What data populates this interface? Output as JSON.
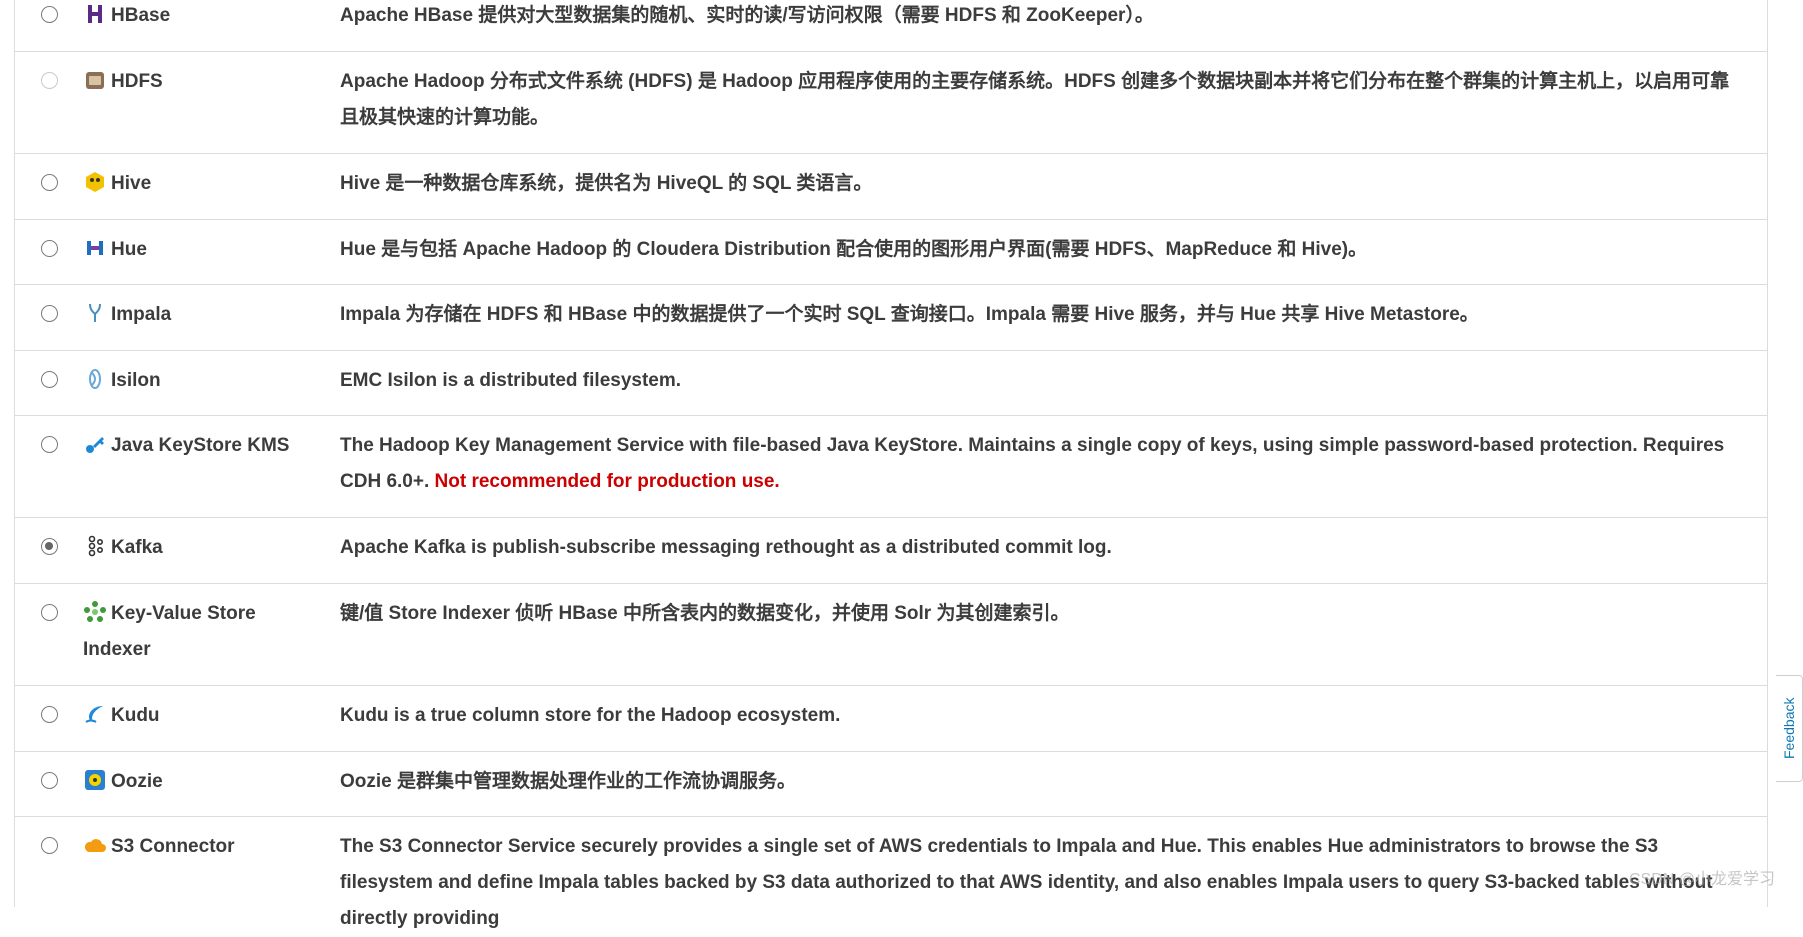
{
  "rows": [
    {
      "name": "HBase",
      "icon": "hbase-icon",
      "desc": "Apache HBase 提供对大型数据集的随机、实时的读/写访问权限（需要 HDFS 和 ZooKeeper）。"
    },
    {
      "name": "HDFS",
      "icon": "hdfs-icon",
      "desc": "Apache Hadoop 分布式文件系统 (HDFS) 是 Hadoop 应用程序使用的主要存储系统。HDFS 创建多个数据块副本并将它们分布在整个群集的计算主机上，以启用可靠且极其快速的计算功能。"
    },
    {
      "name": "Hive",
      "icon": "hive-icon",
      "desc": "Hive 是一种数据仓库系统，提供名为 HiveQL 的 SQL 类语言。"
    },
    {
      "name": "Hue",
      "icon": "hue-icon",
      "desc": "Hue 是与包括 Apache Hadoop 的 Cloudera Distribution 配合使用的图形用户界面(需要 HDFS、MapReduce 和 Hive)。"
    },
    {
      "name": "Impala",
      "icon": "impala-icon",
      "desc": "Impala 为存储在 HDFS 和 HBase 中的数据提供了一个实时 SQL 查询接口。Impala 需要 Hive 服务，并与 Hue 共享 Hive Metastore。"
    },
    {
      "name": "Isilon",
      "icon": "isilon-icon",
      "desc": "EMC Isilon is a distributed filesystem."
    },
    {
      "name": "Java KeyStore KMS",
      "icon": "java-keystore-icon",
      "desc": "The Hadoop Key Management Service with file-based Java KeyStore. Maintains a single copy of keys, using simple password-based protection. Requires CDH 6.0+.",
      "warning": "Not recommended for production use."
    },
    {
      "name": "Kafka",
      "icon": "kafka-icon",
      "desc": "Apache Kafka is publish-subscribe messaging rethought as a distributed commit log."
    },
    {
      "name": "Key-Value Store Indexer",
      "icon": "key-value-store-icon",
      "desc": "键/值 Store Indexer 侦听 HBase 中所含表内的数据变化，并使用 Solr 为其创建索引。"
    },
    {
      "name": "Kudu",
      "icon": "kudu-icon",
      "desc": "Kudu is a true column store for the Hadoop ecosystem."
    },
    {
      "name": "Oozie",
      "icon": "oozie-icon",
      "desc": "Oozie 是群集中管理数据处理作业的工作流协调服务。"
    },
    {
      "name": "S3 Connector",
      "icon": "s3-connector-icon",
      "desc": "The S3 Connector Service securely provides a single set of AWS credentials to Impala and Hue. This enables Hue administrators to browse the S3 filesystem and define Impala tables backed by S3 data authorized to that AWS identity, and also enables Impala users to query S3-backed tables without directly providing"
    }
  ],
  "selected_service": "Kafka",
  "disabled_service": "HDFS",
  "feedback_label": "Feedback",
  "watermark": "CSDN @小龙爱学习"
}
